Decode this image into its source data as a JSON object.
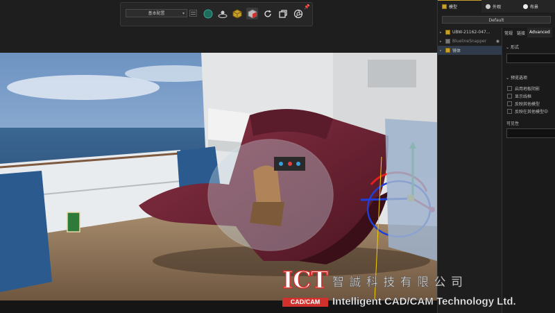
{
  "toolbar": {
    "preset_label": "基本配置",
    "icons": [
      "palette-icon",
      "turntable-icon",
      "cube-icon",
      "box-icon",
      "reload-icon",
      "render-icon",
      "camera-shutter-icon"
    ]
  },
  "panel": {
    "tabs": [
      {
        "label": "模型",
        "icon": "cube-icon"
      },
      {
        "label": "外观",
        "icon": "sphere-icon"
      },
      {
        "label": "布景",
        "icon": "scene-icon"
      }
    ],
    "default_label": "Default",
    "tree": [
      {
        "label": "UBW-21162-047...",
        "state": "normal"
      },
      {
        "label": "BluelineSnapper",
        "state": "dim"
      },
      {
        "label": "镜体",
        "state": "selected"
      }
    ],
    "subtabs": [
      "常规",
      "链接",
      "Advanced"
    ],
    "section_shape": "形式",
    "section_preview": "预览选项",
    "preview_options": [
      "启用地板阴影",
      "显示线框",
      "反映其他模型",
      "反映在其他模型中"
    ],
    "visibility_label": "可见性"
  },
  "watermark": {
    "logo_top": "ICT",
    "logo_bottom": "CAD/CAM",
    "company_cn": "智 誠 科 技 有 限 公 司",
    "company_en": "Intelligent CAD/CAM Technology Ltd."
  },
  "colors": {
    "accent": "#c9a12a",
    "brand_red": "#d0312d",
    "hull": "#6e2233"
  }
}
